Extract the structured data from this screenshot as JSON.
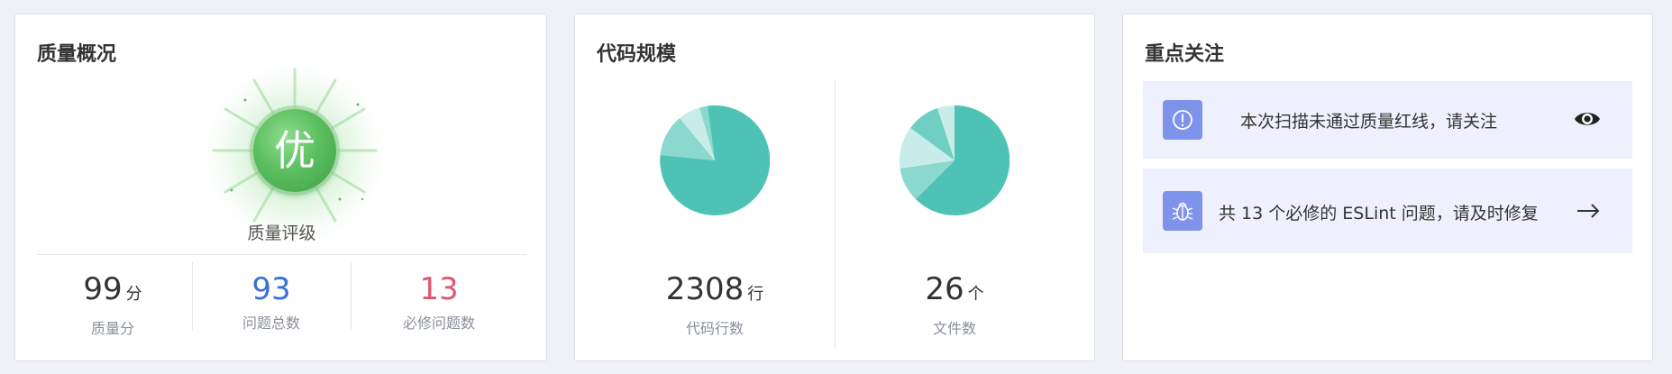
{
  "quality": {
    "title": "质量概况",
    "grade": "优",
    "rating_label": "质量评级",
    "stats": [
      {
        "value": "99",
        "unit": "分",
        "label": "质量分",
        "color": "#333333"
      },
      {
        "value": "93",
        "unit": "",
        "label": "问题总数",
        "color": "#3a6fd8"
      },
      {
        "value": "13",
        "unit": "",
        "label": "必修问题数",
        "color": "#e0566e"
      }
    ]
  },
  "scale": {
    "title": "代码规模",
    "lines": {
      "value": "2308",
      "unit": "行",
      "label": "代码行数"
    },
    "files": {
      "value": "26",
      "unit": "个",
      "label": "文件数"
    },
    "pie_colors": [
      "#4ec3b5",
      "#8ad8ce",
      "#c8ecea",
      "#e0f4f2"
    ]
  },
  "focus": {
    "title": "重点关注",
    "items": [
      {
        "icon": "alert-circle-icon",
        "text": "本次扫描未通过质量红线，请关注",
        "action_icon": "eye-icon"
      },
      {
        "icon": "bug-icon",
        "text": "共 13 个必修的 ESLint 问题，请及时修复",
        "action_icon": "arrow-right-icon"
      }
    ]
  }
}
